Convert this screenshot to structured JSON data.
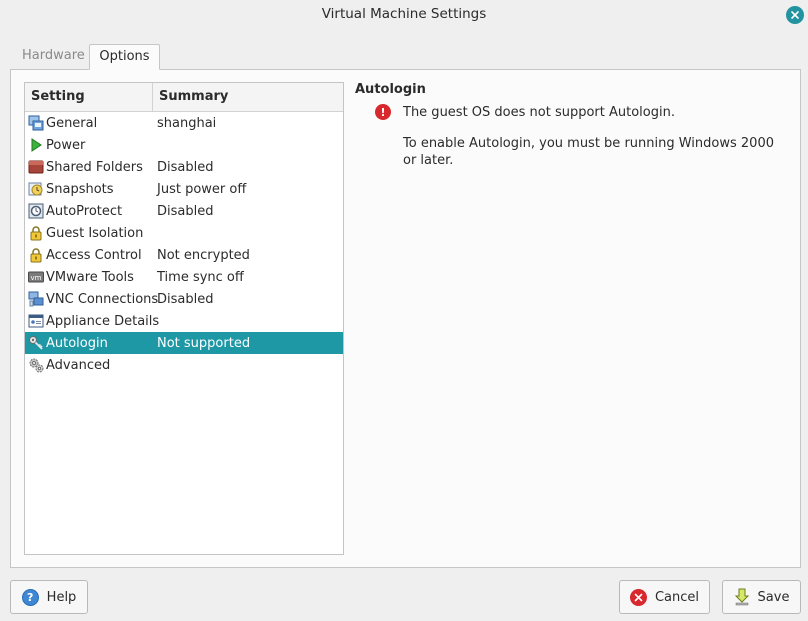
{
  "window": {
    "title": "Virtual Machine Settings"
  },
  "tabs": [
    {
      "label": "Hardware",
      "active": false
    },
    {
      "label": "Options",
      "active": true
    }
  ],
  "list": {
    "headers": {
      "setting": "Setting",
      "summary": "Summary"
    },
    "rows": [
      {
        "icon": "general-icon",
        "setting": "General",
        "summary": "shanghai"
      },
      {
        "icon": "power-icon",
        "setting": "Power",
        "summary": ""
      },
      {
        "icon": "shared-folders-icon",
        "setting": "Shared Folders",
        "summary": "Disabled"
      },
      {
        "icon": "snapshots-icon",
        "setting": "Snapshots",
        "summary": "Just power off"
      },
      {
        "icon": "autoprotect-icon",
        "setting": "AutoProtect",
        "summary": "Disabled"
      },
      {
        "icon": "lock-icon",
        "setting": "Guest Isolation",
        "summary": ""
      },
      {
        "icon": "lock-icon",
        "setting": "Access Control",
        "summary": "Not encrypted"
      },
      {
        "icon": "vm-icon",
        "setting": "VMware Tools",
        "summary": "Time sync off"
      },
      {
        "icon": "vnc-icon",
        "setting": "VNC Connections",
        "summary": "Disabled"
      },
      {
        "icon": "appliance-icon",
        "setting": "Appliance Details",
        "summary": ""
      },
      {
        "icon": "key-icon",
        "setting": "Autologin",
        "summary": "Not supported",
        "selected": true
      },
      {
        "icon": "gears-icon",
        "setting": "Advanced",
        "summary": ""
      }
    ]
  },
  "detail": {
    "title": "Autologin",
    "error_icon": "error-icon",
    "message1": "The guest OS does not support Autologin.",
    "message2": "To enable Autologin, you must be running Windows 2000 or later."
  },
  "buttons": {
    "help": "Help",
    "cancel": "Cancel",
    "save": "Save"
  },
  "colors": {
    "accent": "#1f98a6",
    "error": "#d9272e",
    "help": "#3f86d3"
  }
}
